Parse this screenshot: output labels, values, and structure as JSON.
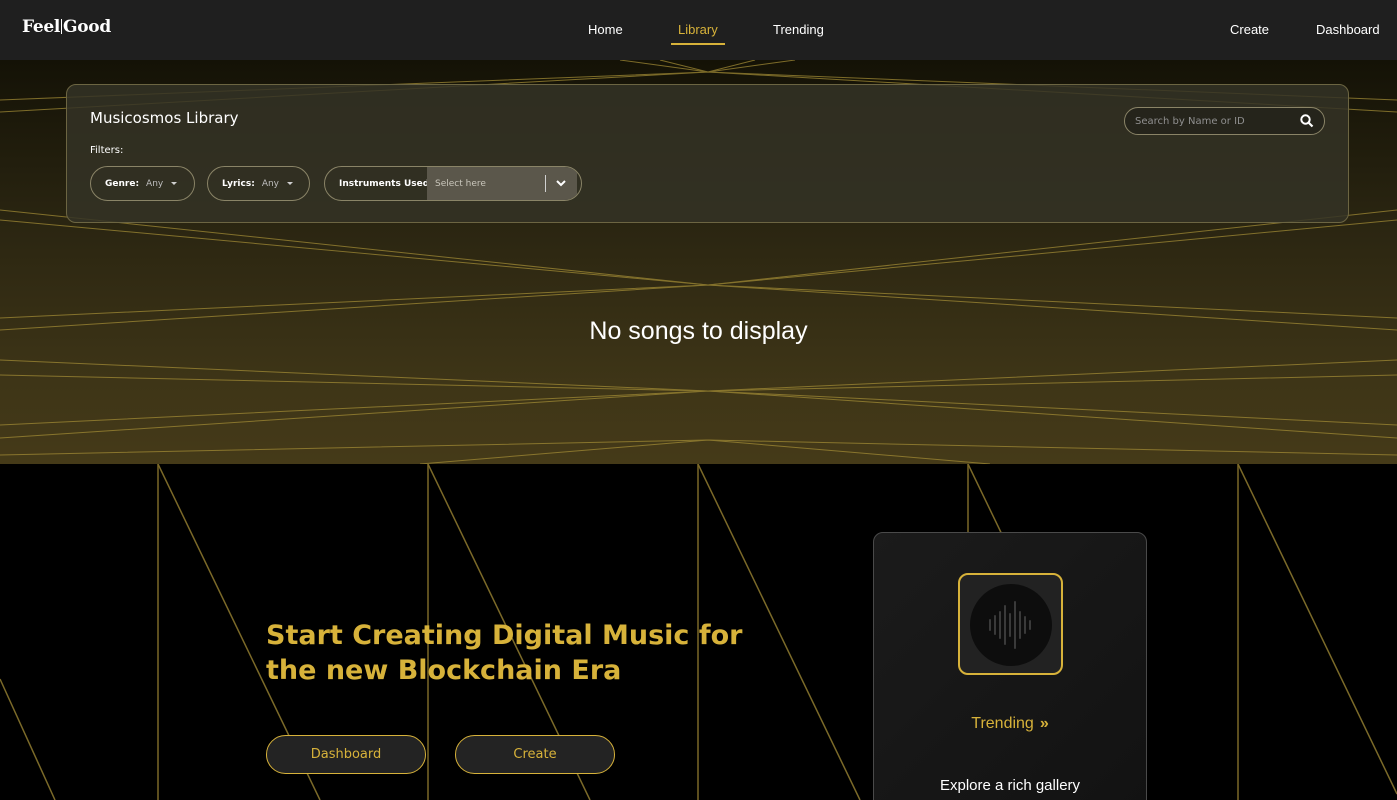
{
  "navbar": {
    "logo_left": "Feel",
    "logo_right": "Good",
    "links": [
      {
        "label": "Home"
      },
      {
        "label": "Library"
      },
      {
        "label": "Trending"
      }
    ],
    "right_links": [
      {
        "label": "Create"
      },
      {
        "label": "Dashboard"
      }
    ],
    "active_link": "Library"
  },
  "library": {
    "title": "Musicosmos Library",
    "filters_label": "Filters:",
    "genre": {
      "label": "Genre:",
      "value": "Any"
    },
    "lyrics": {
      "label": "Lyrics:",
      "value": "Any"
    },
    "instruments": {
      "label": "Instruments Used:",
      "placeholder": "Select here"
    },
    "search": {
      "placeholder": "Search by Name or ID"
    },
    "empty_message": "No songs to display"
  },
  "hero": {
    "title": "Start Creating Digital Music for the new Blockchain Era",
    "dashboard_button": "Dashboard",
    "create_button": "Create"
  },
  "trending_card": {
    "link_label": "Trending",
    "description": "Explore a rich gallery"
  },
  "colors": {
    "accent": "#d7b23a",
    "navbar_bg": "#1f1f1f",
    "page_bg": "#000000"
  },
  "icons": [
    "search-icon",
    "chevron-down-icon",
    "caret-down-icon",
    "sound-wave-icon",
    "double-chevron-right-icon"
  ]
}
